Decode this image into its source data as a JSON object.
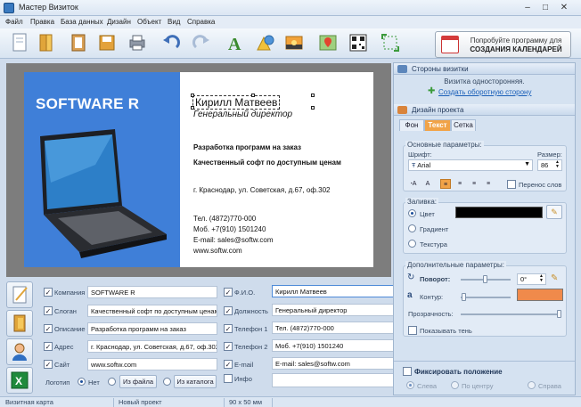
{
  "app": {
    "title": "Мастер Визиток"
  },
  "menu": [
    "Файл",
    "Правка",
    "База данных",
    "Дизайн",
    "Объект",
    "Вид",
    "Справка"
  ],
  "toolbar": {
    "icons": [
      "new-document-icon",
      "open-folder-icon",
      "clipboard-icon",
      "save-icon",
      "print-icon",
      "undo-icon",
      "redo-icon",
      "text-icon",
      "shapes-icon",
      "image-icon",
      "map-pin-icon",
      "qr-code-icon",
      "crop-icon"
    ],
    "calendar_promo_line1": "Попробуйте программу для",
    "calendar_promo_line2": "СОЗДАНИЯ КАЛЕНДАРЕЙ"
  },
  "card": {
    "company": "SOFTWARE R",
    "name": "Кирилл Матвеев",
    "position": "Генеральный директор",
    "description": "Разработка программ на заказ",
    "slogan": "Качественный софт по доступным ценам",
    "address": "г. Краснодар, ул. Советская, д.67, оф.302",
    "phone1": "Тел. (4872)770-000",
    "phone2": "Моб. +7(910) 1501240",
    "email": "E-mail: sales@softw.com",
    "site": "www.softw.com"
  },
  "form": {
    "left": [
      {
        "label": "Компания",
        "value": "SOFTWARE R"
      },
      {
        "label": "Слоган",
        "value": "Качественный софт по доступным ценам"
      },
      {
        "label": "Описание",
        "value": "Разработка программ на заказ"
      },
      {
        "label": "Адрес",
        "value": "г. Краснодар, ул. Советская, д.67, оф.302"
      },
      {
        "label": "Сайт",
        "value": "www.softw.com"
      }
    ],
    "right": [
      {
        "label": "Ф.И.О.",
        "value": "Кирилл Матвеев"
      },
      {
        "label": "Должность",
        "value": "Генеральный директор"
      },
      {
        "label": "Телефон 1",
        "value": "Тел. (4872)770-000"
      },
      {
        "label": "Телефон 2",
        "value": "Моб. +7(910) 1501240"
      },
      {
        "label": "E-mail",
        "value": "E-mail: sales@softw.com"
      },
      {
        "label": "Инфо",
        "value": ""
      }
    ],
    "logo_label": "Логотип",
    "logo_none": "Нет",
    "from_file": "Из файла",
    "from_catalog": "Из каталога"
  },
  "panel": {
    "sides_title": "Стороны визитки",
    "sides_info": "Визитка односторонняя.",
    "sides_link": "Создать оборотную сторону",
    "design_title": "Дизайн проекта",
    "tabs": [
      "Фон",
      "Текст",
      "Сетка"
    ],
    "active_tab": "Текст",
    "basic_title": "Основные параметры:",
    "font_label": "Шрифт:",
    "font_value": "Arial",
    "size_label": "Размер:",
    "size_value": "86",
    "wrap_label": "Перенос слов",
    "fill_title": "Заливка:",
    "fill_color": "Цвет",
    "fill_gradient": "Градиент",
    "fill_texture": "Текстура",
    "fill_swatch": "#000000",
    "extra_title": "Дополнительные параметры:",
    "rotation_label": "Поворот:",
    "rotation_value": "0°",
    "outline_label": "Контур:",
    "outline_color": "#f08a4b",
    "opacity_label": "Прозрачность:",
    "shadow_label": "Показывать тень",
    "fix_label": "Фиксировать положение",
    "align_left": "Слева",
    "align_center": "По центру",
    "align_right": "Справа"
  },
  "status": {
    "left": "Визитная карта",
    "project": "Новый проект",
    "size": "90 x 50 мм"
  },
  "colors": {
    "card_blue": "#3f7fd8",
    "accent_orange": "#f1a347"
  }
}
